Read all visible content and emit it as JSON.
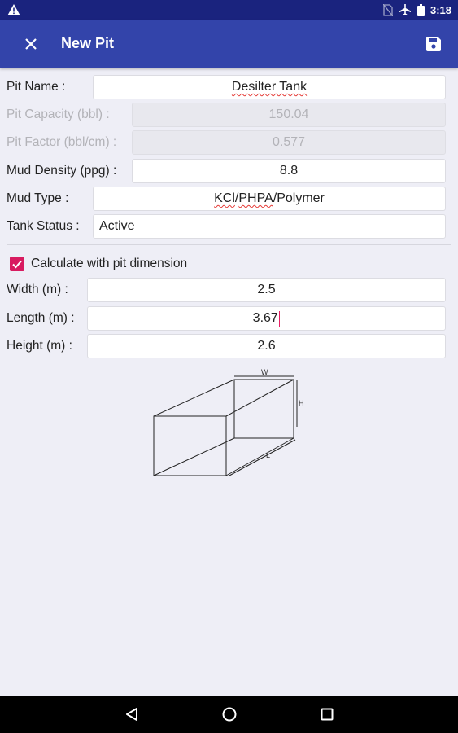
{
  "status_bar": {
    "time": "3:18",
    "icons": [
      "warning-icon",
      "no-sim-icon",
      "airplane-icon",
      "battery-icon"
    ]
  },
  "app_bar": {
    "title": "New Pit",
    "close_icon": "close-icon",
    "save_icon": "save-icon"
  },
  "form": {
    "pit_name": {
      "label": "Pit Name :",
      "value": "Desilter Tank"
    },
    "pit_capacity": {
      "label": "Pit Capacity (bbl) :",
      "value": "150.04"
    },
    "pit_factor": {
      "label": "Pit Factor (bbl/cm) :",
      "value": "0.577"
    },
    "mud_density": {
      "label": "Mud Density (ppg) :",
      "value": "8.8"
    },
    "mud_type": {
      "label": "Mud Type :",
      "value_parts": [
        "KCl",
        "/",
        "PHPA",
        "/Polymer"
      ]
    },
    "tank_status": {
      "label": "Tank Status :",
      "value": "Active"
    }
  },
  "dimensions": {
    "calc_checkbox": {
      "label": "Calculate with pit dimension",
      "checked": true
    },
    "width": {
      "label": "Width (m) :",
      "value": "2.5"
    },
    "length": {
      "label": "Length (m) :",
      "value": "3.67"
    },
    "height": {
      "label": "Height (m) :",
      "value": "2.6"
    }
  },
  "diagram": {
    "w_label": "W",
    "h_label": "H",
    "l_label": "L"
  },
  "nav_bar": {
    "icons": [
      "back-icon",
      "home-icon",
      "recents-icon"
    ]
  },
  "colors": {
    "status_bar": "#1a237e",
    "app_bar": "#3344aa",
    "accent": "#d81b60",
    "background": "#eeeef6"
  }
}
